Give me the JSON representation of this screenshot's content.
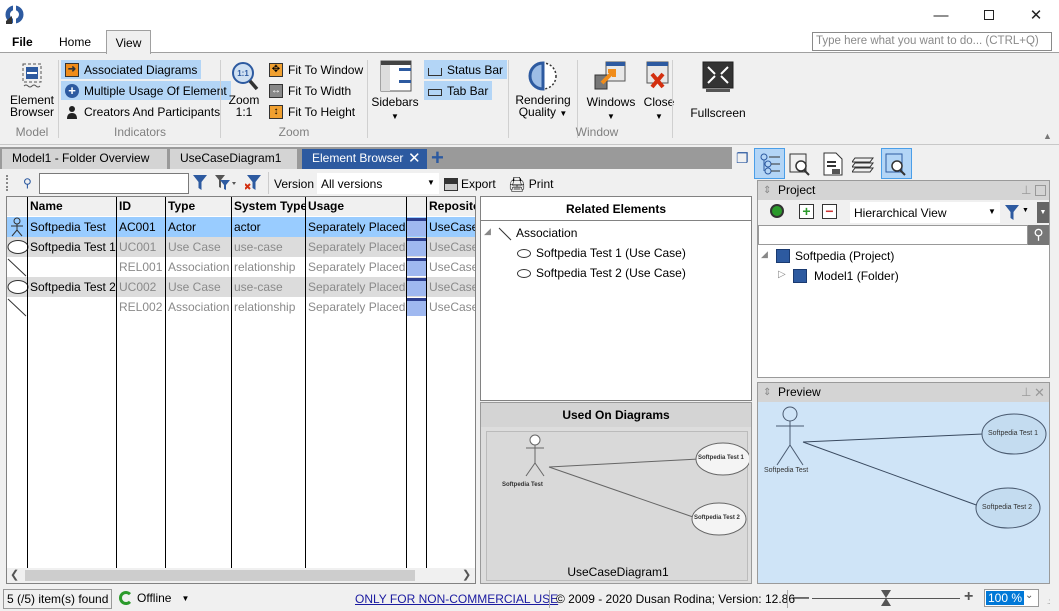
{
  "window": {
    "minimize_icon": "minimize-icon",
    "maximize_icon": "maximize-icon",
    "close_icon": "close-icon"
  },
  "menu": {
    "tabs": [
      "File",
      "Home",
      "View"
    ],
    "active": "View",
    "command_search_placeholder": "Type here what you want to do...  (CTRL+Q)"
  },
  "ribbon": {
    "groups": {
      "model": {
        "label": "Model",
        "element_browser": "Element\nBrowser"
      },
      "indicators": {
        "label": "Indicators",
        "items": [
          {
            "label": "Associated Diagrams",
            "checked": true
          },
          {
            "label": "Multiple Usage Of Element",
            "checked": true
          },
          {
            "label": "Creators And Participants",
            "checked": false
          }
        ]
      },
      "zoom": {
        "label": "Zoom",
        "zoom11_line1": "Zoom",
        "zoom11_line2": "1:1",
        "items": [
          "Fit To Window",
          "Fit To Width",
          "Fit To Height"
        ]
      },
      "layout": {
        "sidebars": "Sidebars",
        "status_bar": "Status Bar",
        "tab_bar": "Tab Bar"
      },
      "window": {
        "label": "Window",
        "rendering_line1": "Rendering",
        "rendering_line2": "Quality",
        "windows": "Windows",
        "close": "Close",
        "fullscreen": "Fullscreen"
      }
    }
  },
  "doc_tabs": [
    {
      "label": "Model1 - Folder Overview",
      "active": false
    },
    {
      "label": "UseCaseDiagram1",
      "active": false
    },
    {
      "label": "Element Browser",
      "active": true
    }
  ],
  "element_browser": {
    "filter_value": "",
    "version_label": "Version",
    "version_value": "All versions",
    "export_label": "Export",
    "print_label": "Print",
    "columns": [
      "Name",
      "ID",
      "Type",
      "System Type",
      "Usage",
      "",
      "Reposito"
    ],
    "rows": [
      {
        "icon": "actor",
        "name": "Softpedia Test",
        "id": "AC001",
        "type": "Actor",
        "system_type": "actor",
        "usage": "Separately Placed",
        "repository": "UseCase",
        "selected": true
      },
      {
        "icon": "use-case",
        "name": "Softpedia Test 1",
        "id": "UC001",
        "type": "Use Case",
        "system_type": "use-case",
        "usage": "Separately Placed",
        "repository": "UseCase",
        "selected": false
      },
      {
        "icon": "association",
        "name": "",
        "id": "REL001",
        "type": "Association",
        "system_type": "relationship",
        "usage": "Separately Placed",
        "repository": "UseCase",
        "selected": false
      },
      {
        "icon": "use-case",
        "name": "Softpedia Test 2",
        "id": "UC002",
        "type": "Use Case",
        "system_type": "use-case",
        "usage": "Separately Placed",
        "repository": "UseCase",
        "selected": false
      },
      {
        "icon": "association",
        "name": "",
        "id": "REL002",
        "type": "Association",
        "system_type": "relationship",
        "usage": "Separately Placed",
        "repository": "UseCase",
        "selected": false
      }
    ]
  },
  "related_elements": {
    "title": "Related Elements",
    "group": "Association",
    "items": [
      "Softpedia Test 1 (Use Case)",
      "Softpedia Test 2 (Use Case)"
    ]
  },
  "used_on_diagrams": {
    "title": "Used On Diagrams",
    "diagram_name": "UseCaseDiagram1",
    "actor": "Softpedia Test",
    "use_cases": [
      "Softpedia Test 1",
      "Softpedia Test 2"
    ]
  },
  "project_panel": {
    "title": "Project",
    "view_mode": "Hierarchical View",
    "search_value": "",
    "tree": [
      {
        "label": "Softpedia (Project)",
        "expanded": true
      },
      {
        "label": "Model1 (Folder)",
        "expanded": false
      }
    ]
  },
  "preview_panel": {
    "title": "Preview",
    "actor": "Softpedia Test",
    "use_cases": [
      "Softpedia Test 1",
      "Softpedia Test 2"
    ]
  },
  "status_bar": {
    "items_found": "5 (/5) item(s) found",
    "connection": "Offline",
    "license_link": "ONLY FOR NON-COMMERCIAL USE",
    "copyright": "© 2009 - 2020 Dusan Rodina; Version: 12.86",
    "zoom_value": "100 %",
    "zoom_percent": 100
  },
  "colors": {
    "accent": "#2d5aa0",
    "selection": "#99ccff",
    "toggle_on": "#b3d5f6",
    "preview_bg": "#cfe4f7"
  }
}
